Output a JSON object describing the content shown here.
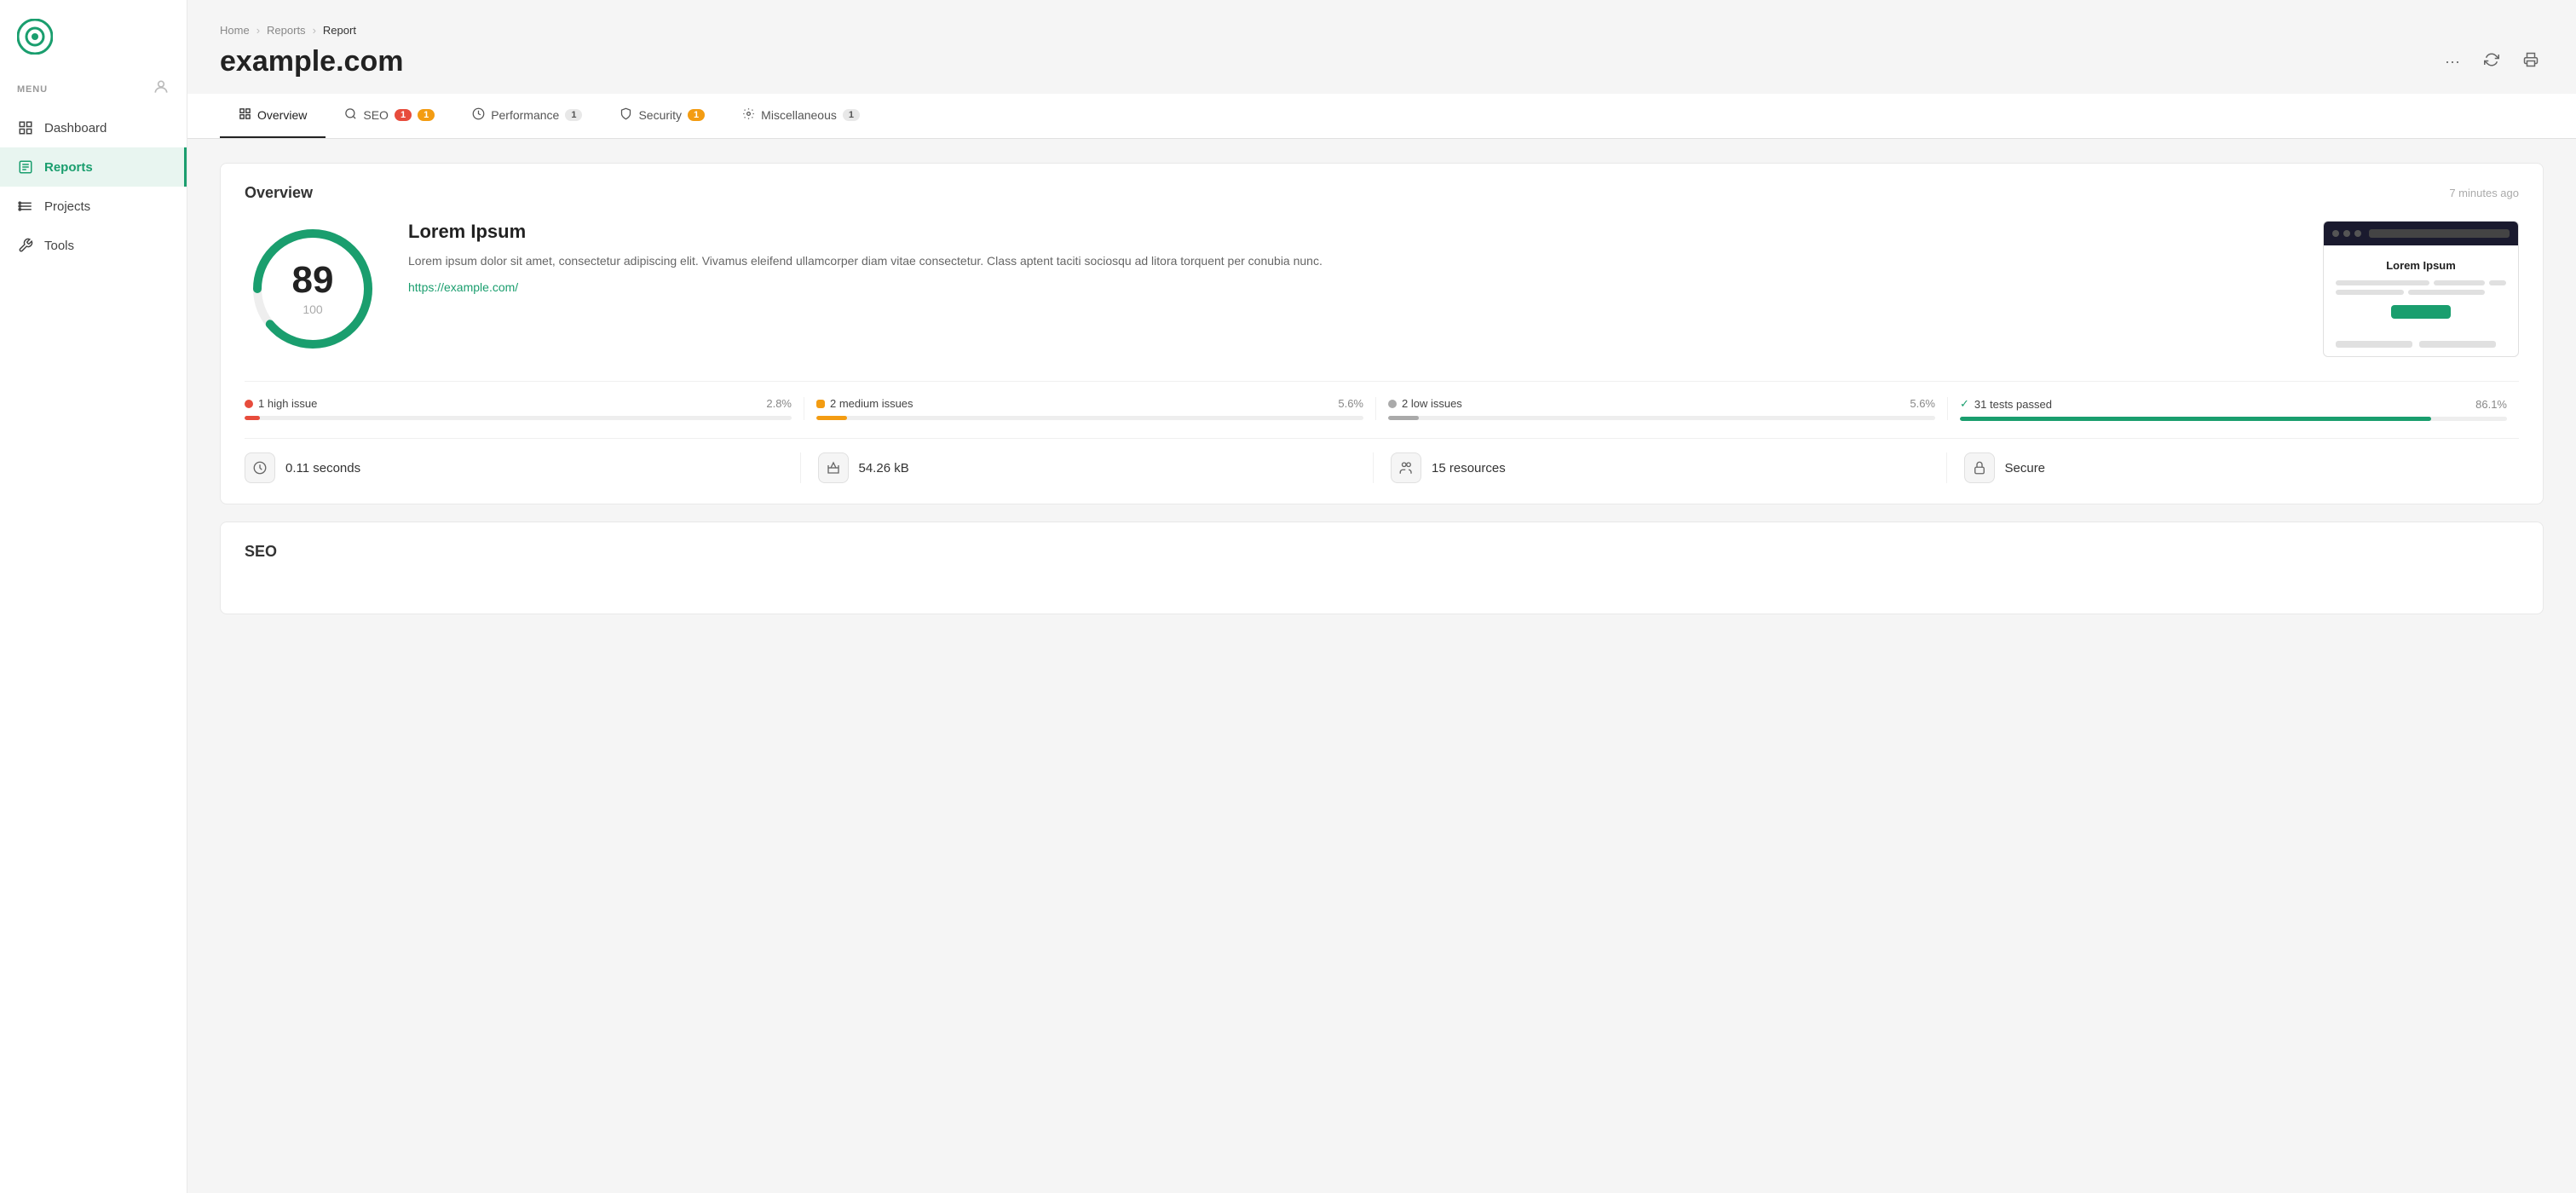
{
  "sidebar": {
    "menu_label": "MENU",
    "items": [
      {
        "id": "dashboard",
        "label": "Dashboard",
        "active": false
      },
      {
        "id": "reports",
        "label": "Reports",
        "active": true
      },
      {
        "id": "projects",
        "label": "Projects",
        "active": false
      },
      {
        "id": "tools",
        "label": "Tools",
        "active": false
      }
    ]
  },
  "breadcrumb": {
    "home": "Home",
    "reports": "Reports",
    "current": "Report"
  },
  "page": {
    "title": "example.com"
  },
  "tabs": [
    {
      "id": "overview",
      "label": "Overview",
      "badge": null,
      "active": true
    },
    {
      "id": "seo",
      "label": "SEO",
      "badge": "1",
      "badge2": "1",
      "active": false
    },
    {
      "id": "performance",
      "label": "Performance",
      "badge": "1",
      "active": false
    },
    {
      "id": "security",
      "label": "Security",
      "badge": "1",
      "badge_color": "yellow",
      "active": false
    },
    {
      "id": "miscellaneous",
      "label": "Miscellaneous",
      "badge": "1",
      "active": false
    }
  ],
  "overview": {
    "title": "Overview",
    "time": "7 minutes ago",
    "score": {
      "value": 89,
      "max": 100,
      "percentage": 89
    },
    "site": {
      "name": "Lorem Ipsum",
      "description": "Lorem ipsum dolor sit amet, consectetur adipiscing elit. Vivamus eleifend ullamcorper diam vitae consectetur. Class aptent taciti sociosqu ad litora torquent per conubia nunc.",
      "url": "https://example.com/",
      "preview_title": "Lorem Ipsum"
    },
    "issues": [
      {
        "id": "high",
        "label": "1 high issue",
        "pct": "2.8%",
        "fill_pct": 2.8,
        "color": "#e74c3c",
        "type": "high"
      },
      {
        "id": "medium",
        "label": "2 medium issues",
        "pct": "5.6%",
        "fill_pct": 5.6,
        "color": "#f39c12",
        "type": "medium"
      },
      {
        "id": "low",
        "label": "2 low issues",
        "pct": "5.6%",
        "fill_pct": 5.6,
        "color": "#aaa",
        "type": "low"
      },
      {
        "id": "passed",
        "label": "31 tests passed",
        "pct": "86.1%",
        "fill_pct": 86.1,
        "color": "#1a9e6e",
        "type": "passed"
      }
    ],
    "metrics": [
      {
        "id": "speed",
        "icon": "⏱",
        "value": "0.11 seconds"
      },
      {
        "id": "size",
        "icon": "⚖",
        "value": "54.26 kB"
      },
      {
        "id": "resources",
        "icon": "👥",
        "value": "15 resources"
      },
      {
        "id": "secure",
        "icon": "🔒",
        "value": "Secure"
      }
    ]
  },
  "seo_section": {
    "title": "SEO"
  },
  "colors": {
    "accent": "#1a9e6e",
    "sidebar_active_bg": "#e8f5f0"
  }
}
